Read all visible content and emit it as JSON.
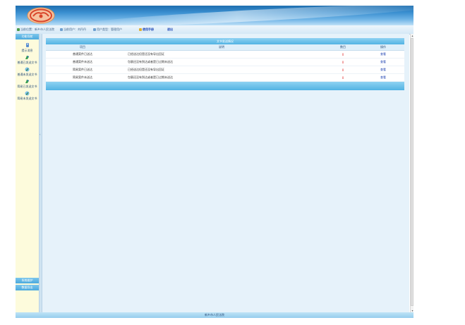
{
  "colors": {
    "accent": "#4ba9dd",
    "link": "#1a3fb0",
    "count": "#e02a2a",
    "sidebar_bg": "#fdfbdc"
  },
  "header": {
    "logo_icon": "court-emblem-icon"
  },
  "infobar": {
    "home_text": "当前位置：新乡市人民法院",
    "user_text": "当前用户：刘丹丹",
    "type_text": "用户类型：管理用户",
    "help_label": "使用手册",
    "exit_label": "退出"
  },
  "sidebar": {
    "header": "功能导航",
    "items": [
      {
        "label": "提示消息",
        "icon": "message-icon"
      },
      {
        "label": "普通已发送文书",
        "icon": "send-document-icon"
      },
      {
        "label": "普通未发送文书",
        "icon": "pending-document-icon"
      },
      {
        "label": "简易已发送文书",
        "icon": "send-document-icon"
      },
      {
        "label": "简易未发送文书",
        "icon": "pending-document-icon"
      }
    ],
    "bottom_buttons": [
      "系统维护",
      "数据导出"
    ]
  },
  "panel": {
    "title": "文书发送情况",
    "columns": [
      "项目",
      "说明",
      "数目",
      "操作"
    ],
    "rows": [
      {
        "item": "普通案件已送达",
        "desc": "已经送达但是还没有导出回证",
        "count": "0",
        "action": "查看"
      },
      {
        "item": "普通案件未送达",
        "desc": "包裹还没有到达或者是已过期未送达",
        "count": "0",
        "action": "查看"
      },
      {
        "item": "简易案件已送达",
        "desc": "已经送达但是还没有导出回证",
        "count": "0",
        "action": "查看"
      },
      {
        "item": "简易案件未送达",
        "desc": "包裹还没有到达或者是已过期未送达",
        "count": "0",
        "action": "查看"
      }
    ]
  },
  "footer": {
    "text": "新乡市人民法院"
  }
}
